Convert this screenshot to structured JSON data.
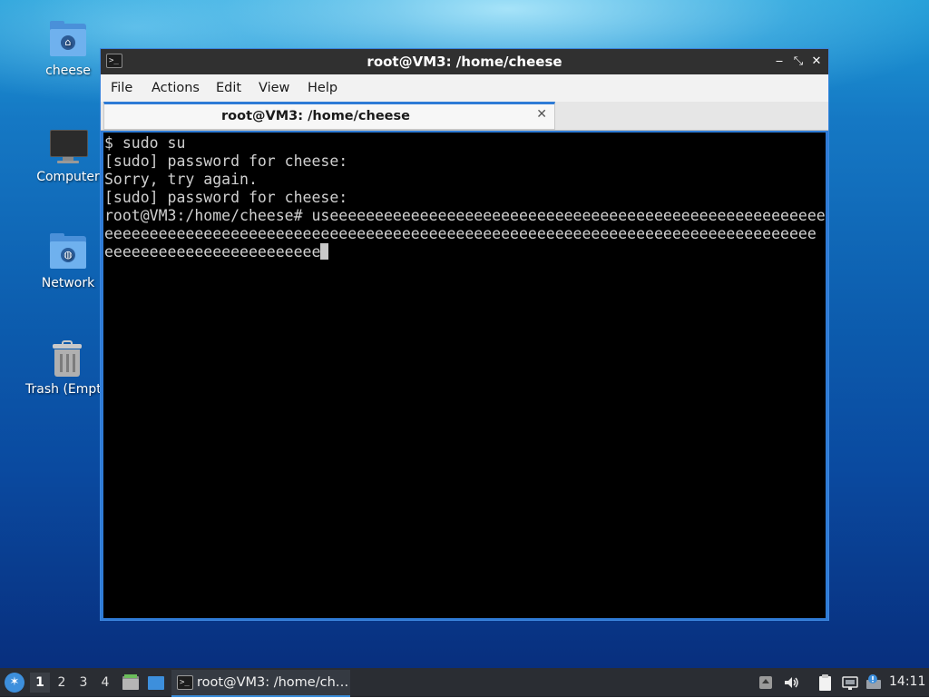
{
  "desktop": {
    "icons": [
      {
        "label": "cheese",
        "icon": "home-folder-icon"
      },
      {
        "label": "Computer",
        "icon": "computer-icon"
      },
      {
        "label": "Network",
        "icon": "network-folder-icon"
      },
      {
        "label": "Trash (Empt",
        "icon": "trash-icon"
      }
    ]
  },
  "window": {
    "title": "root@VM3: /home/cheese",
    "app_icon_text": ">_",
    "controls": {
      "minimize": "‒",
      "maximize": "⤡",
      "close": "✕"
    },
    "menu": [
      "File",
      "Actions",
      "Edit",
      "View",
      "Help"
    ],
    "tab": {
      "label": "root@VM3: /home/cheese",
      "close": "✕"
    }
  },
  "terminal": {
    "lines": [
      "$ sudo su",
      "[sudo] password for cheese:",
      "Sorry, try again.",
      "[sudo] password for cheese:",
      "root@VM3:/home/cheese# useeeeeeeeeeeeeeeeeeeeeeeeeeeeeeeeeeeeeeeeeeeeeeeeeeeeeee",
      "eeeeeeeeeeeeeeeeeeeeeeeeeeeeeeeeeeeeeeeeeeeeeeeeeeeeeeeeeeeeeeeeeeeeeeeeeeeeeee",
      "eeeeeeeeeeeeeeeeeeeeeeee"
    ]
  },
  "taskbar": {
    "start_icon": "lubuntu-start-icon",
    "workspaces": [
      "1",
      "2",
      "3",
      "4"
    ],
    "active_workspace": "1",
    "quicklaunch": [
      "file-manager-icon",
      "show-desktop-icon"
    ],
    "task": {
      "label": "root@VM3: /home/ch…",
      "icon": "terminal-icon",
      "icon_text": ">_"
    },
    "tray": [
      "upload-icon",
      "volume-icon",
      "clipboard-icon",
      "network-icon",
      "update-notifier-icon"
    ],
    "clock": "14:11"
  },
  "colors": {
    "accent": "#2e7bd6",
    "titlebar": "#303030",
    "terminal_bg": "#000000",
    "terminal_fg": "#d0d0d0",
    "taskbar": "#2a2d33"
  }
}
